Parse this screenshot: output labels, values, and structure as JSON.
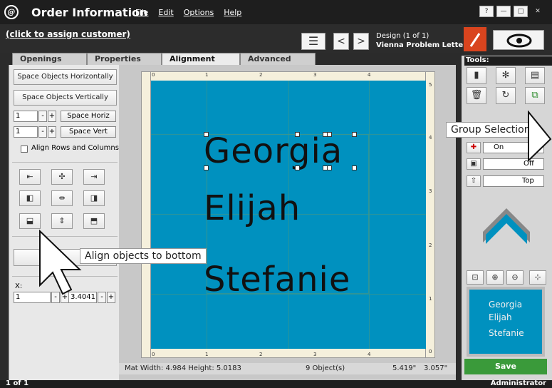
{
  "titlebar": {
    "logo": "@",
    "title": "Order Information",
    "menu": [
      "File",
      "Edit",
      "Options",
      "Help"
    ],
    "window_buttons": [
      "?",
      "—",
      "□",
      "✕"
    ]
  },
  "header": {
    "assign_customer": "(click to assign customer)",
    "design_label": "Design  (1 of 1)",
    "design_name": "Vienna Problem Letters"
  },
  "tabs": [
    {
      "label": "Openings",
      "active": false
    },
    {
      "label": "Properties",
      "active": false
    },
    {
      "label": "Alignment",
      "active": true
    },
    {
      "label": "Advanced",
      "active": false
    }
  ],
  "left": {
    "space_h_btn": "Space Objects Horizontally",
    "space_v_btn": "Space Objects Vertically",
    "h_value": "1",
    "v_value": "1",
    "space_horiz": "Space Horiz",
    "space_vert": "Space Vert",
    "align_rows": "Align Rows and Columns",
    "x_label": "X:",
    "x_value": "1",
    "y_value": "3.4041",
    "minus": "-",
    "plus": "+"
  },
  "canvas": {
    "ruler_top": [
      "0",
      "1",
      "2",
      "3",
      "4"
    ],
    "ruler_side": [
      "5",
      "4",
      "3",
      "2",
      "1",
      "0"
    ],
    "lines": [
      "Georgia",
      "Elijah",
      "Stefanie"
    ],
    "mat_color": "#0091bf"
  },
  "status": {
    "mat_size": "Mat Width: 4.984  Height: 5.0183",
    "objects": "9 Object(s)",
    "coord_x": "5.419\"",
    "coord_y": "3.057\""
  },
  "tools": {
    "label": "Tools:",
    "tooltip": "Group Selection",
    "on_label": "On",
    "off_label": "Off",
    "top_label": "Top",
    "preview_lines": [
      "Georgia",
      "Elijah",
      "Stefanie"
    ],
    "save": "Save"
  },
  "tooltip_align": "Align objects to bottom",
  "footer": {
    "page": "1 of 1",
    "user": "Administrator"
  },
  "colors": {
    "accent": "#d9441e",
    "save": "#3a9a3a",
    "mat": "#0091bf"
  }
}
